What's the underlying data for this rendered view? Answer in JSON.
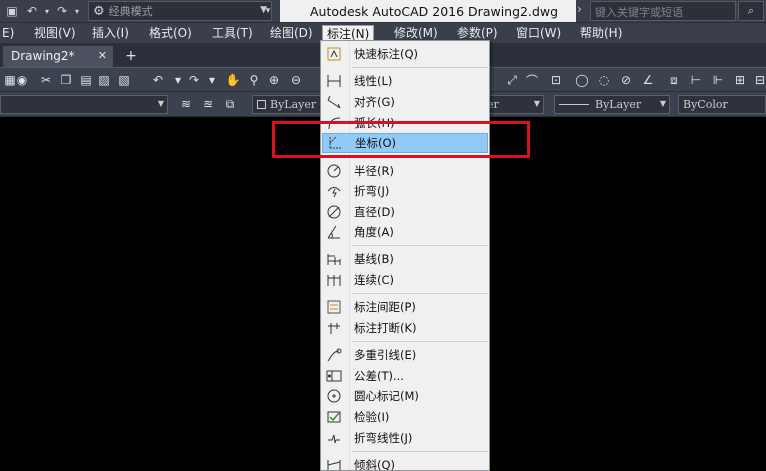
{
  "titlebar": {
    "workspace": "经典模式",
    "title": "Autodesk AutoCAD 2016    Drawing2.dwg",
    "search_placeholder": "键入关键字或短语"
  },
  "menubar": {
    "items": [
      {
        "label": "E)"
      },
      {
        "label": "视图(V)"
      },
      {
        "label": "插入(I)"
      },
      {
        "label": "格式(O)"
      },
      {
        "label": "工具(T)"
      },
      {
        "label": "绘图(D)"
      },
      {
        "label": "标注(N)"
      },
      {
        "label": "修改(M)"
      },
      {
        "label": "参数(P)"
      },
      {
        "label": "窗口(W)"
      },
      {
        "label": "帮助(H)"
      }
    ]
  },
  "tabs": {
    "active": "Drawing2*",
    "close": "✕",
    "new": "+"
  },
  "toolbar2": {
    "layer": "ByLayer",
    "linetype": "er",
    "lineweight": "ByLayer",
    "color": "ByColor"
  },
  "dropdown": {
    "items": [
      {
        "label": "快速标注(Q)",
        "icon": "quick-dimension-icon"
      },
      {
        "label": "线性(L)",
        "icon": "linear-icon"
      },
      {
        "label": "对齐(G)",
        "icon": "aligned-icon"
      },
      {
        "label": "弧长(H)",
        "icon": "arc-length-icon"
      },
      {
        "label": "坐标(O)",
        "icon": "ordinate-icon"
      },
      {
        "label": "半径(R)",
        "icon": "radius-icon"
      },
      {
        "label": "折弯(J)",
        "icon": "jogged-icon"
      },
      {
        "label": "直径(D)",
        "icon": "diameter-icon"
      },
      {
        "label": "角度(A)",
        "icon": "angular-icon"
      },
      {
        "label": "基线(B)",
        "icon": "baseline-icon"
      },
      {
        "label": "连续(C)",
        "icon": "continue-icon"
      },
      {
        "label": "标注间距(P)",
        "icon": "dimension-space-icon"
      },
      {
        "label": "标注打断(K)",
        "icon": "dimension-break-icon"
      },
      {
        "label": "多重引线(E)",
        "icon": "multileader-icon"
      },
      {
        "label": "公差(T)...",
        "icon": "tolerance-icon"
      },
      {
        "label": "圆心标记(M)",
        "icon": "center-mark-icon"
      },
      {
        "label": "检验(I)",
        "icon": "inspection-icon"
      },
      {
        "label": "折弯线性(J)",
        "icon": "jogged-linear-icon"
      },
      {
        "label": "倾斜(Q)",
        "icon": "oblique-icon"
      }
    ]
  },
  "colors": {
    "selected": "#91c9f7",
    "highlight": "#d8121b",
    "chrome": "#3a3f4b"
  }
}
